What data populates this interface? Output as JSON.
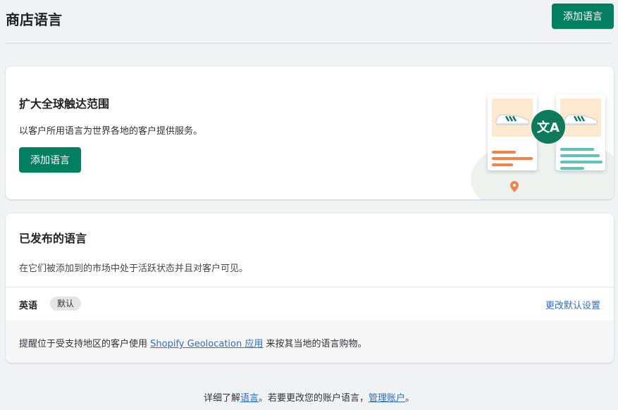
{
  "header": {
    "title": "商店语言",
    "add_button": "添加语言"
  },
  "promo": {
    "title": "扩大全球触达范围",
    "description": "以客户所用语言为世界各地的客户提供服务。",
    "button": "添加语言",
    "translate_glyph": "文A",
    "icons": [
      "shoe-icon",
      "translate-icon",
      "location-pin-icon"
    ],
    "colors": {
      "brand": "#008060",
      "accent_orange": "#f0844c",
      "accent_teal": "#5dc5b8",
      "shoe_bg": "#fde9cf"
    }
  },
  "published": {
    "title": "已发布的语言",
    "description": "在它们被添加到的市场中处于活跃状态并且对客户可见。",
    "languages": [
      {
        "name": "英语",
        "badge": "默认",
        "action": "更改默认设置"
      }
    ],
    "notice": {
      "prefix": "提醒位于受支持地区的客户使用 ",
      "link": "Shopify Geolocation 应用",
      "suffix": " 来按其当地的语言购物。"
    }
  },
  "footer": {
    "prefix": "详细了解",
    "link1": "语言",
    "middle": "。若要更改您的账户语言，",
    "link2": "管理账户",
    "suffix": "。"
  }
}
